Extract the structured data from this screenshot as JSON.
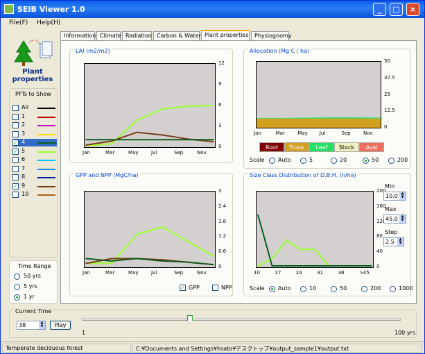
{
  "window": {
    "title": "SEIB Viewer 1.0",
    "minimize": "_",
    "maximize": "□",
    "close": "×"
  },
  "menu": [
    {
      "label": "File(F)"
    },
    {
      "label": "Help(H)"
    }
  ],
  "tabs": [
    {
      "label": "Information"
    },
    {
      "label": "Climate"
    },
    {
      "label": "Radiation"
    },
    {
      "label": "Carbon & Water"
    },
    {
      "label": "Plant properties",
      "active": true
    },
    {
      "label": "Physiognomy"
    }
  ],
  "header": {
    "title": "Plant properties",
    "icon": "tree-document-icon"
  },
  "pfts": {
    "title": "PFTs to Show",
    "items": [
      {
        "label": "All",
        "checked": false,
        "color": "#000000"
      },
      {
        "label": "1",
        "checked": false,
        "color": "#c00000"
      },
      {
        "label": "2",
        "checked": false,
        "color": "#c000c0"
      },
      {
        "label": "3",
        "checked": false,
        "color": "#ffd800"
      },
      {
        "label": "4",
        "checked": true,
        "color": "#0b5d1e",
        "selected": true
      },
      {
        "label": "5",
        "checked": true,
        "color": "#9aff2c"
      },
      {
        "label": "6",
        "checked": false,
        "color": "#00c0ff"
      },
      {
        "label": "7",
        "checked": false,
        "color": "#1e90ff"
      },
      {
        "label": "8",
        "checked": false,
        "color": "#0020a0"
      },
      {
        "label": "9",
        "checked": true,
        "color": "#7b3d17"
      },
      {
        "label": "10",
        "checked": false,
        "color": "#b06010"
      }
    ]
  },
  "time_range": {
    "title": "Time Range",
    "options": [
      {
        "label": "50 yrs",
        "on": false
      },
      {
        "label": "5 yrs",
        "on": false
      },
      {
        "label": "1 yr",
        "on": true
      }
    ]
  },
  "lai": {
    "title": "LAI (m2/m2)",
    "yticks": [
      "12",
      "9",
      "6",
      "3",
      "0"
    ],
    "xticks": [
      "Jan",
      "Mar",
      "May",
      "Jul",
      "Sep",
      "Nov"
    ]
  },
  "gpp": {
    "title": "GPP and NPP (MgC/ha)",
    "yticks": [
      "3",
      "2.4",
      "1.8",
      "1.2",
      "0.6",
      "0"
    ],
    "xticks": [
      "Jan",
      "Mar",
      "May",
      "Jul",
      "Sep",
      "Nov"
    ],
    "gpp_label": "GPP",
    "npp_label": "NPP",
    "gpp_checked": true,
    "npp_checked": false
  },
  "allocation": {
    "title": "Allocation (Mg C / ha)",
    "yticks": [
      "50",
      "37.5",
      "25",
      "12.5",
      "0"
    ],
    "xticks": [
      "Jan",
      "Mar",
      "May",
      "Jul",
      "Sep",
      "Nov"
    ],
    "legend": [
      {
        "label": "Root",
        "bg": "#800000",
        "fg": "#ffffff"
      },
      {
        "label": "Trunk",
        "bg": "#d4a020",
        "fg": "#ffffff"
      },
      {
        "label": "Leaf",
        "bg": "#22e060",
        "fg": "#ffffff"
      },
      {
        "label": "Stock",
        "bg": "#f0f0c0",
        "fg": "#000000"
      },
      {
        "label": "Aval",
        "bg": "#f07060",
        "fg": "#ffffff"
      }
    ],
    "scale_label": "Scale",
    "scale_options": [
      {
        "label": "Auto",
        "on": false
      },
      {
        "label": "5",
        "on": false
      },
      {
        "label": "20",
        "on": false
      },
      {
        "label": "50",
        "on": true
      },
      {
        "label": "200",
        "on": false
      }
    ]
  },
  "dbh": {
    "title": "Size Class Distribution of D.B.H. (n/ha)",
    "yticks": [
      "200",
      "160",
      "120",
      "80",
      "40",
      "0"
    ],
    "xticks": [
      "10",
      "17",
      "24",
      "31",
      "38",
      ">45"
    ],
    "scale_label": "Scale",
    "scale_options": [
      {
        "label": "Auto",
        "on": true
      },
      {
        "label": "10",
        "on": false
      },
      {
        "label": "50",
        "on": false
      },
      {
        "label": "200",
        "on": false
      },
      {
        "label": "1000",
        "on": false
      }
    ],
    "min_label": "Min",
    "min_value": "10.0",
    "max_label": "Max",
    "max_value": "45.0",
    "step_label": "Step",
    "step_value": "2.5"
  },
  "current_time": {
    "title": "Current Time",
    "value": "38",
    "play_label": "Play",
    "slider_min": "1",
    "slider_max": "100 yrs",
    "slider_fraction": 0.33
  },
  "status": {
    "left": "Temperate deciduous forest",
    "path": "C:¥Documents and Settings¥hsato¥デスクトップ¥output_sample1¥output.txt"
  },
  "chart_data": [
    {
      "type": "line",
      "title": "LAI (m2/m2)",
      "x": [
        "Jan",
        "Mar",
        "May",
        "Jul",
        "Sep",
        "Nov"
      ],
      "ylim": [
        0,
        12
      ],
      "series": [
        {
          "color": "#9aff2c",
          "values": [
            0,
            0.3,
            3.8,
            5.5,
            5.9,
            6.0
          ]
        },
        {
          "color": "#7b3d17",
          "values": [
            0.1,
            0.7,
            2.0,
            1.6,
            1.0,
            0.6
          ]
        },
        {
          "color": "#0b5d1e",
          "values": [
            0.9,
            0.9,
            0.9,
            0.9,
            0.9,
            0.9
          ]
        }
      ]
    },
    {
      "type": "line",
      "title": "GPP and NPP (MgC/ha)",
      "x": [
        "Jan",
        "Mar",
        "May",
        "Jul",
        "Sep",
        "Nov"
      ],
      "ylim": [
        0,
        3
      ],
      "series": [
        {
          "color": "#9aff2c",
          "values": [
            0.1,
            0.1,
            1.3,
            1.6,
            1.0,
            0.4
          ]
        },
        {
          "color": "#7b3d17",
          "values": [
            0.1,
            0.3,
            0.3,
            0.25,
            0.15,
            0.05
          ]
        },
        {
          "color": "#0b5d1e",
          "values": [
            0.3,
            0.2,
            0.3,
            0.2,
            0.15,
            0.05
          ]
        }
      ]
    },
    {
      "type": "area",
      "title": "Allocation (Mg C / ha)",
      "x": [
        "Jan",
        "Mar",
        "May",
        "Jul",
        "Sep",
        "Nov"
      ],
      "ylim": [
        0,
        50
      ],
      "series": [
        {
          "name": "Trunk",
          "values": [
            7,
            7,
            7,
            7,
            7,
            7
          ]
        },
        {
          "name": "Leaf",
          "values": [
            0.4,
            0.4,
            0.6,
            0.8,
            0.8,
            0.6
          ]
        }
      ]
    },
    {
      "type": "line",
      "title": "Size Class Distribution of D.B.H. (n/ha)",
      "x": [
        10,
        12.5,
        15,
        17.5,
        20,
        22.5,
        25,
        30,
        45
      ],
      "ylim": [
        0,
        200
      ],
      "series": [
        {
          "color": "#9aff2c",
          "values": [
            0,
            20,
            70,
            45,
            45,
            0,
            0,
            0,
            0
          ]
        },
        {
          "color": "#0b5d1e",
          "values": [
            140,
            0,
            0,
            0,
            0,
            0,
            0,
            0,
            0
          ]
        }
      ]
    }
  ]
}
